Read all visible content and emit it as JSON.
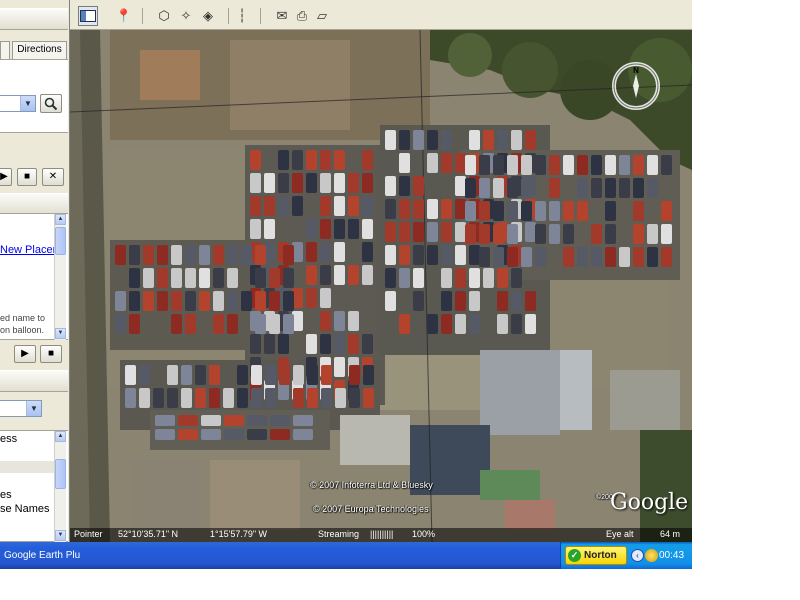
{
  "left_panel": {
    "tabs": [
      {
        "label": ""
      },
      {
        "label": "Directions"
      }
    ],
    "places": {
      "link_text": "New Placem",
      "help_line1": "ed name to",
      "help_line2": "on balloon."
    },
    "layers": {
      "items": [
        "ess",
        "es",
        "se Names"
      ]
    }
  },
  "toolbar": {
    "icons": [
      "sidebar-icon",
      "placemark-icon",
      "polygon-icon",
      "path-icon",
      "image-overlay-icon",
      "ruler-icon",
      "email-icon",
      "print-icon",
      "maps-icon"
    ]
  },
  "map": {
    "copyright1": "© 2007 Infoterra Ltd & Bluesky",
    "copyright2": "© 2007 Europa Technologies",
    "copyright3": "©2007",
    "logo": "Google",
    "compass_n": "N",
    "status": {
      "pointer_label": "Pointer",
      "lat": "52°10'35.71\" N",
      "lon": "1°15'57.79\" W",
      "streaming_label": "Streaming",
      "streaming_bar": "||||||||||",
      "streaming_pct": "100%",
      "eye_label": "Eye alt",
      "eye_value": "64 m"
    }
  },
  "taskbar": {
    "task": "Google Earth Plus",
    "norton": "Norton",
    "clock": "00:43"
  }
}
